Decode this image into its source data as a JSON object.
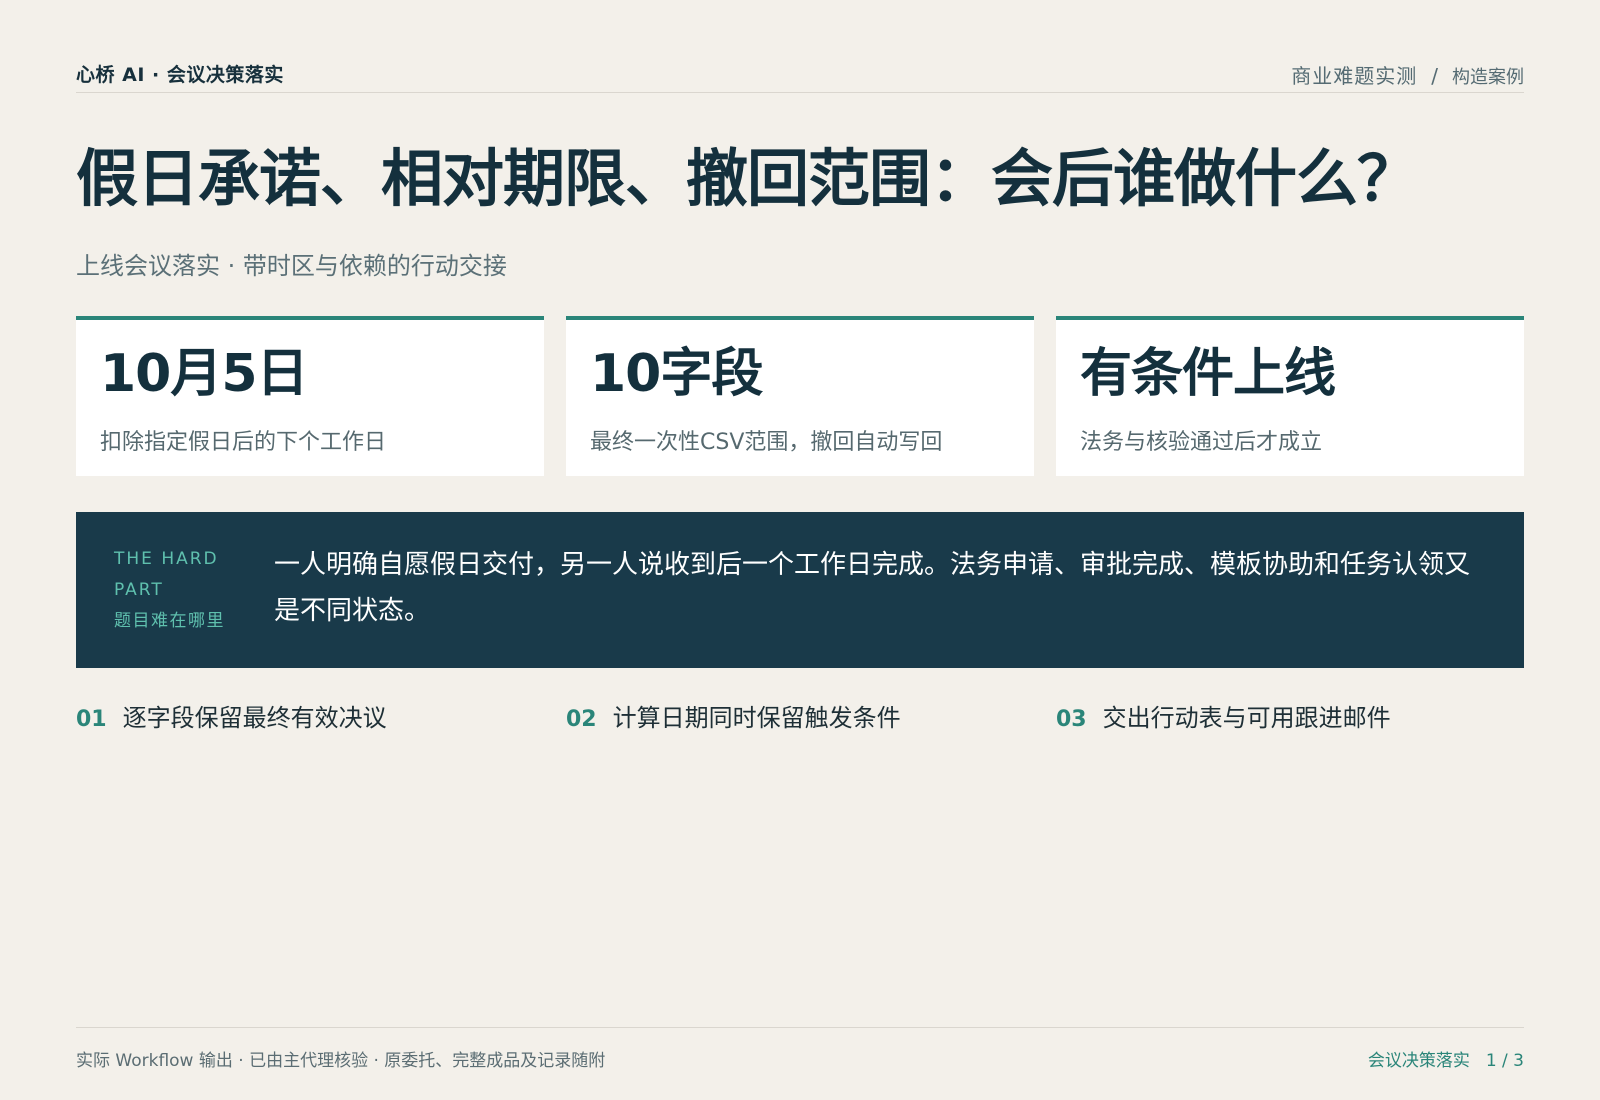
{
  "header": {
    "brand": "心桥 AI · 会议决策落实",
    "crumb_1": "商业难题实测",
    "crumb_sep": "/",
    "crumb_2": "构造案例"
  },
  "title": "假日承诺、相对期限、撤回范围：会后谁做什么？",
  "subtitle": "上线会议落实 · 带时区与依赖的行动交接",
  "stats": [
    {
      "value": "10月5日",
      "desc": "扣除指定假日后的下个工作日"
    },
    {
      "value": "10字段",
      "desc": "最终一次性CSV范围，撤回自动写回"
    },
    {
      "value": "有条件上线",
      "desc": "法务与核验通过后才成立"
    }
  ],
  "hard_part": {
    "label_en": "THE HARD PART",
    "label_cn": "题目难在哪里",
    "text": "一人明确自愿假日交付，另一人说收到后一个工作日完成。法务申请、审批完成、模板协助和任务认领又是不同状态。"
  },
  "steps": [
    {
      "num": "01",
      "text": "逐字段保留最终有效决议"
    },
    {
      "num": "02",
      "text": "计算日期同时保留触发条件"
    },
    {
      "num": "03",
      "text": "交出行动表与可用跟进邮件"
    }
  ],
  "footer": {
    "note": "实际 Workflow 输出 · 已由主代理核验 · 原委托、完整成品及记录随附",
    "section": "会议决策落实",
    "page": "1 / 3"
  },
  "colors": {
    "background": "#f3f0ea",
    "accent": "#2a8579",
    "dark_panel": "#193a4a",
    "heading": "#14303d"
  }
}
